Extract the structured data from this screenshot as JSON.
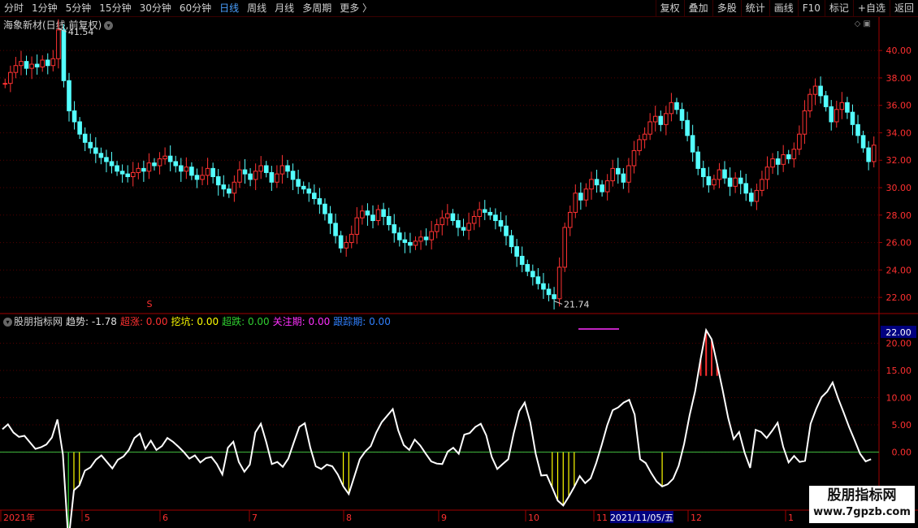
{
  "toolbar": {
    "periods": [
      "分时",
      "1分钟",
      "5分钟",
      "15分钟",
      "30分钟",
      "60分钟",
      "日线",
      "周线",
      "月线",
      "多周期",
      "更多 〉"
    ],
    "active": "日线",
    "buttons": [
      "复权",
      "叠加",
      "多股",
      "统计",
      "画线",
      "F10",
      "标记",
      "+自选",
      "返回"
    ]
  },
  "main_chart": {
    "title": "海象新材(日线,前复权)",
    "high_label": "41.54",
    "low_label": "21.74",
    "y_ticks": [
      "40.00",
      "38.00",
      "36.00",
      "34.00",
      "32.00",
      "30.00",
      "28.00",
      "26.00",
      "24.00",
      "22.00"
    ],
    "marker_s": "S"
  },
  "indicator": {
    "name": "股朋指标网",
    "items": [
      {
        "label": "趋势:",
        "value": "-1.78",
        "color": "#e0e0e0"
      },
      {
        "label": "超涨:",
        "value": "0.00",
        "color": "#ff3030"
      },
      {
        "label": "挖坑:",
        "value": "0.00",
        "color": "#ffff00"
      },
      {
        "label": "超跌:",
        "value": "0.00",
        "color": "#30d030"
      },
      {
        "label": "关注期:",
        "value": "0.00",
        "color": "#ff30ff"
      },
      {
        "label": "跟踪期:",
        "value": "0.00",
        "color": "#3080ff"
      }
    ],
    "y_ticks": [
      "20.00",
      "15.00",
      "10.00",
      "5.00",
      "0.00"
    ],
    "current_value_box": "22.00"
  },
  "x_axis": {
    "labels": [
      "2021年",
      "5",
      "6",
      "7",
      "8",
      "9",
      "10",
      "11",
      "12",
      "1"
    ],
    "cursor_date": "2021/11/05/五"
  },
  "watermark": {
    "line1": "股朋指标网",
    "line2": "www.7gpzb.com"
  },
  "colors": {
    "up": "#ff3232",
    "down": "#54ffff",
    "grid": "#550000",
    "axis": "#a00000"
  },
  "chart_data": {
    "type": "candlestick",
    "price_range": [
      21.0,
      42.2
    ],
    "closes": [
      37.6,
      38.4,
      38.9,
      39.2,
      38.7,
      39.0,
      38.8,
      39.3,
      38.9,
      39.4,
      41.5,
      37.8,
      35.6,
      34.8,
      33.9,
      33.3,
      32.9,
      32.5,
      32.2,
      31.9,
      31.6,
      31.2,
      31.0,
      30.8,
      31.1,
      31.4,
      31.2,
      31.8,
      31.6,
      32.1,
      32.3,
      31.9,
      31.6,
      31.2,
      31.5,
      30.9,
      30.6,
      30.9,
      31.4,
      30.8,
      30.2,
      29.9,
      29.6,
      30.4,
      31.3,
      31.0,
      30.6,
      31.2,
      31.6,
      31.1,
      30.4,
      31.0,
      31.6,
      31.2,
      30.6,
      30.1,
      29.9,
      29.6,
      29.2,
      28.8,
      28.1,
      27.4,
      26.5,
      25.6,
      26.0,
      26.6,
      27.8,
      28.3,
      28.0,
      27.6,
      28.4,
      27.9,
      27.3,
      26.7,
      26.2,
      26.0,
      25.8,
      26.1,
      26.4,
      26.2,
      26.8,
      27.3,
      27.8,
      28.1,
      27.6,
      27.1,
      26.9,
      27.4,
      27.9,
      28.4,
      28.2,
      28.0,
      27.6,
      27.2,
      26.5,
      25.7,
      25.0,
      24.4,
      23.9,
      23.5,
      23.0,
      22.6,
      22.2,
      21.9,
      24.2,
      27.1,
      28.2,
      29.6,
      29.1,
      29.9,
      30.6,
      30.2,
      29.7,
      30.5,
      31.4,
      31.0,
      30.4,
      31.6,
      32.7,
      33.5,
      33.9,
      34.8,
      35.2,
      34.6,
      35.4,
      36.2,
      35.7,
      34.9,
      33.8,
      32.6,
      31.4,
      30.8,
      30.2,
      30.6,
      31.3,
      30.7,
      30.1,
      30.7,
      30.3,
      29.6,
      29.0,
      29.8,
      30.6,
      31.5,
      32.1,
      31.7,
      32.4,
      32.1,
      32.8,
      33.9,
      35.6,
      36.8,
      37.4,
      36.7,
      35.9,
      34.8,
      35.7,
      36.2,
      35.5,
      34.6,
      33.8,
      32.9,
      31.9,
      33.1
    ],
    "indicator_range": [
      -10.5,
      23.5
    ],
    "trend": [
      4.2,
      5.1,
      3.6,
      2.8,
      3.0,
      1.8,
      0.6,
      0.9,
      1.4,
      2.7,
      6.0,
      -0.4,
      -16.4,
      -7.0,
      -6.1,
      -3.4,
      -2.8,
      -1.4,
      -0.6,
      -1.8,
      -3.0,
      -1.4,
      -0.8,
      0.4,
      2.6,
      3.4,
      0.6,
      2.1,
      0.4,
      1.1,
      2.6,
      1.9,
      1.0,
      0.0,
      -1.2,
      -0.6,
      -1.9,
      -1.1,
      -0.9,
      -2.2,
      -4.1,
      0.8,
      1.9,
      -1.8,
      -3.6,
      -2.3,
      3.6,
      5.2,
      1.8,
      -2.2,
      -1.8,
      -2.7,
      -1.2,
      1.8,
      4.6,
      5.3,
      0.8,
      -2.6,
      -3.1,
      -2.3,
      -2.6,
      -4.1,
      -6.3,
      -7.7,
      -4.5,
      -1.3,
      0.1,
      1.1,
      3.6,
      5.5,
      6.7,
      7.9,
      4.0,
      1.3,
      0.4,
      2.3,
      1.2,
      -0.3,
      -1.7,
      -2.1,
      -2.2,
      0.1,
      0.8,
      -0.3,
      3.2,
      3.5,
      4.6,
      5.2,
      3.1,
      -0.9,
      -3.1,
      -2.2,
      -1.3,
      3.5,
      7.5,
      9.1,
      5.5,
      -0.3,
      -4.3,
      -4.2,
      -6.5,
      -8.9,
      -9.8,
      -8.2,
      -6.4,
      -4.4,
      -5.7,
      -4.8,
      -2.0,
      1.3,
      4.9,
      7.7,
      8.2,
      9.1,
      9.6,
      6.9,
      -1.3,
      -2.0,
      -3.8,
      -5.4,
      -6.3,
      -5.9,
      -4.9,
      -2.5,
      1.5,
      6.8,
      11.2,
      17.1,
      22.4,
      20.7,
      16.2,
      11.4,
      6.3,
      2.4,
      3.7,
      -0.1,
      -2.9,
      4.1,
      3.7,
      2.6,
      3.9,
      5.4,
      1.0,
      -1.9,
      -0.7,
      -1.8,
      -1.6,
      5.2,
      7.9,
      10.1,
      11.1,
      12.8,
      9.9,
      7.3,
      4.6,
      2.2,
      -0.3,
      -1.7,
      -1.3
    ],
    "zero_line_color": "#40c040"
  }
}
